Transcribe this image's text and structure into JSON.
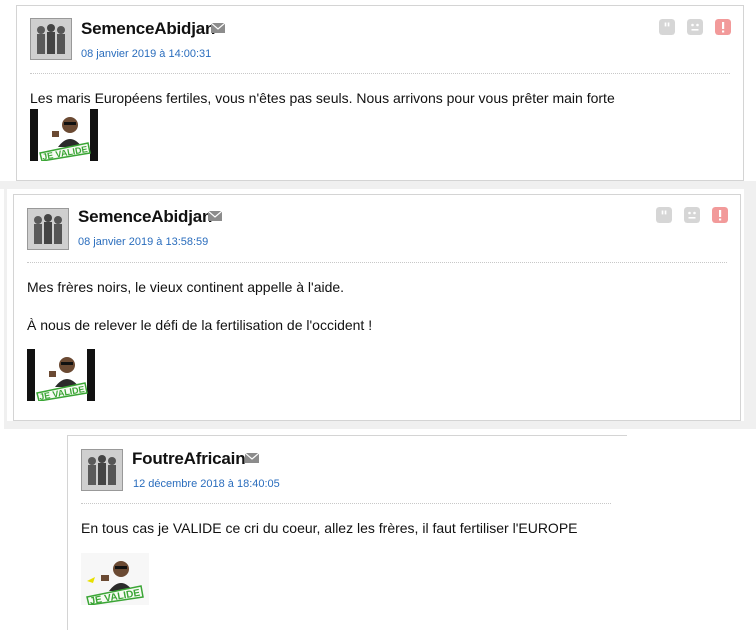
{
  "posts": [
    {
      "author": "SemenceAbidjan",
      "date": "08 janvier 2019 à 14:00:31",
      "paragraphs": [
        "Les maris Européens fertiles, vous n'êtes pas seuls. Nous arrivons pour vous prêter main forte"
      ],
      "sticker_text": "JE VALIDE",
      "sticker_style": "dark"
    },
    {
      "author": "SemenceAbidjan",
      "date": "08 janvier 2019 à 13:58:59",
      "paragraphs": [
        "Mes frères noirs, le vieux continent appelle à l'aide.",
        "À nous de relever le défi de la fertilisation de l'occident !"
      ],
      "sticker_text": "JE VALIDE",
      "sticker_style": "dark"
    },
    {
      "author": "FoutreAfricain",
      "date": "12 décembre 2018 à 18:40:05",
      "paragraphs": [
        "En tous cas je VALIDE ce cri du coeur, allez les frères, il faut fertiliser l'EUROPE"
      ],
      "sticker_text": "JE VALIDE",
      "sticker_style": "light"
    }
  ],
  "icons": {
    "quote": "quote-icon",
    "mp": "mail-icon",
    "sad": "sad-face-icon",
    "alert": "alert-icon"
  },
  "colors": {
    "link": "#2a6dbd",
    "alert": "#f29a9a",
    "icon_gray": "#d6d6d6",
    "sticker_green": "#3aa535"
  }
}
